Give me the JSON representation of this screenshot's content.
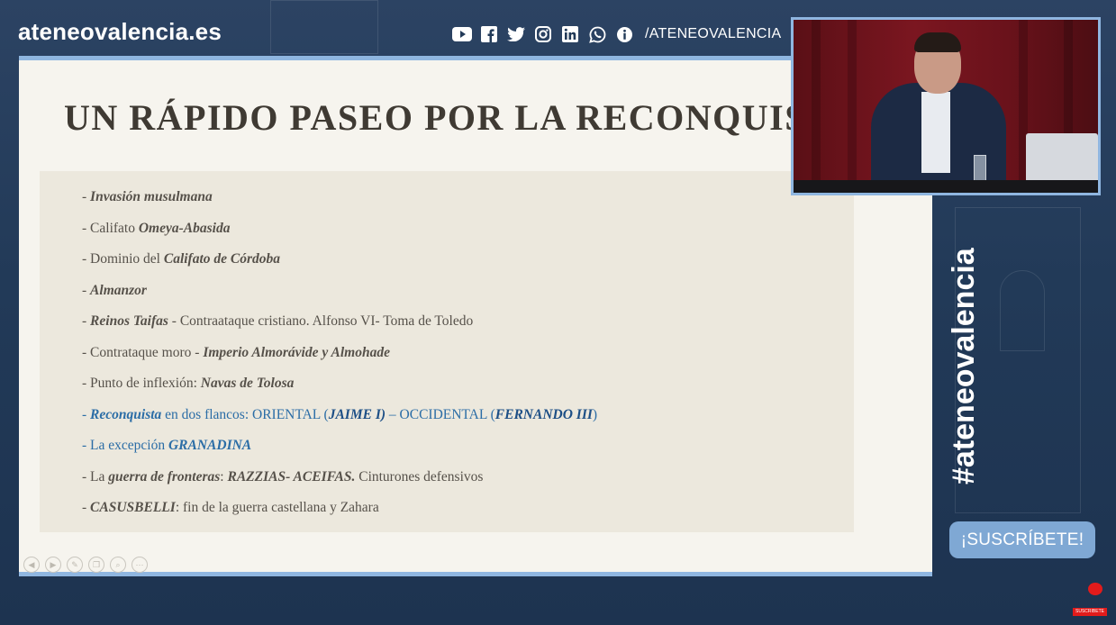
{
  "header": {
    "brand": "ateneovalencia.es",
    "social_handle": "/ATENEOVALENCIA",
    "social_icons": [
      "youtube-icon",
      "facebook-icon",
      "twitter-icon",
      "instagram-icon",
      "linkedin-icon",
      "whatsapp-icon",
      "info-icon"
    ]
  },
  "slide": {
    "title": "UN RÁPIDO PASEO POR LA RECONQUISTA",
    "bullets": [
      {
        "dash": "- ",
        "italic": "Invasión musulmana",
        "rest": ""
      },
      {
        "dash": "- ",
        "pre": "Califato ",
        "italic": "Omeya-Abasida"
      },
      {
        "dash": "- ",
        "pre": "Dominio del ",
        "italic": "Califato de  Córdoba"
      },
      {
        "dash": "- ",
        "italic": "Almanzor"
      },
      {
        "dash": "- ",
        "italic": "Reinos  Taifas",
        "rest": " - Contraataque cristiano. Alfonso VI- Toma de Toledo"
      },
      {
        "dash": "- ",
        "pre": "Contrataque moro - ",
        "italic": "Imperio Almorávide y Almohade"
      },
      {
        "dash": "-  ",
        "pre": "Punto de inflexión: ",
        "italic": "Navas de Tolosa"
      },
      {
        "dash": "- ",
        "italic": "Reconquista",
        "rest": " en dos flancos: ORIENTAL (",
        "italic2": "JAIME I)",
        "rest2": " – OCCIDENTAL (",
        "italic3": "FERNANDO III",
        "rest3": ")"
      },
      {
        "dash": "- ",
        "pre": "La excepción  ",
        "italic": "GRANADINA"
      },
      {
        "dash": "- ",
        "pre": "La ",
        "italic": "guerra de fronteras",
        "rest": ":  ",
        "italic2": "RAZZIAS- ACEIFAS.",
        "rest2": " Cinturones defensivos"
      },
      {
        "dash": "- ",
        "italic": "CASUSBELLI",
        "rest": ": fin de la guerra castellana y Zahara"
      }
    ],
    "controls": [
      "previous-icon",
      "next-icon",
      "pen-icon",
      "copy-icon",
      "zoom-icon",
      "more-icon"
    ]
  },
  "sidebar": {
    "hashtag": "#ateneovalencia",
    "subscribe_label": "¡SUSCRÍBETE!",
    "mini_subscribe_label": "SUSCRIBETE"
  },
  "colors": {
    "background": "#223a58",
    "accent": "#8fb6e0",
    "slide_bg": "#f6f4ee",
    "link_blue": "#2b6da6"
  }
}
